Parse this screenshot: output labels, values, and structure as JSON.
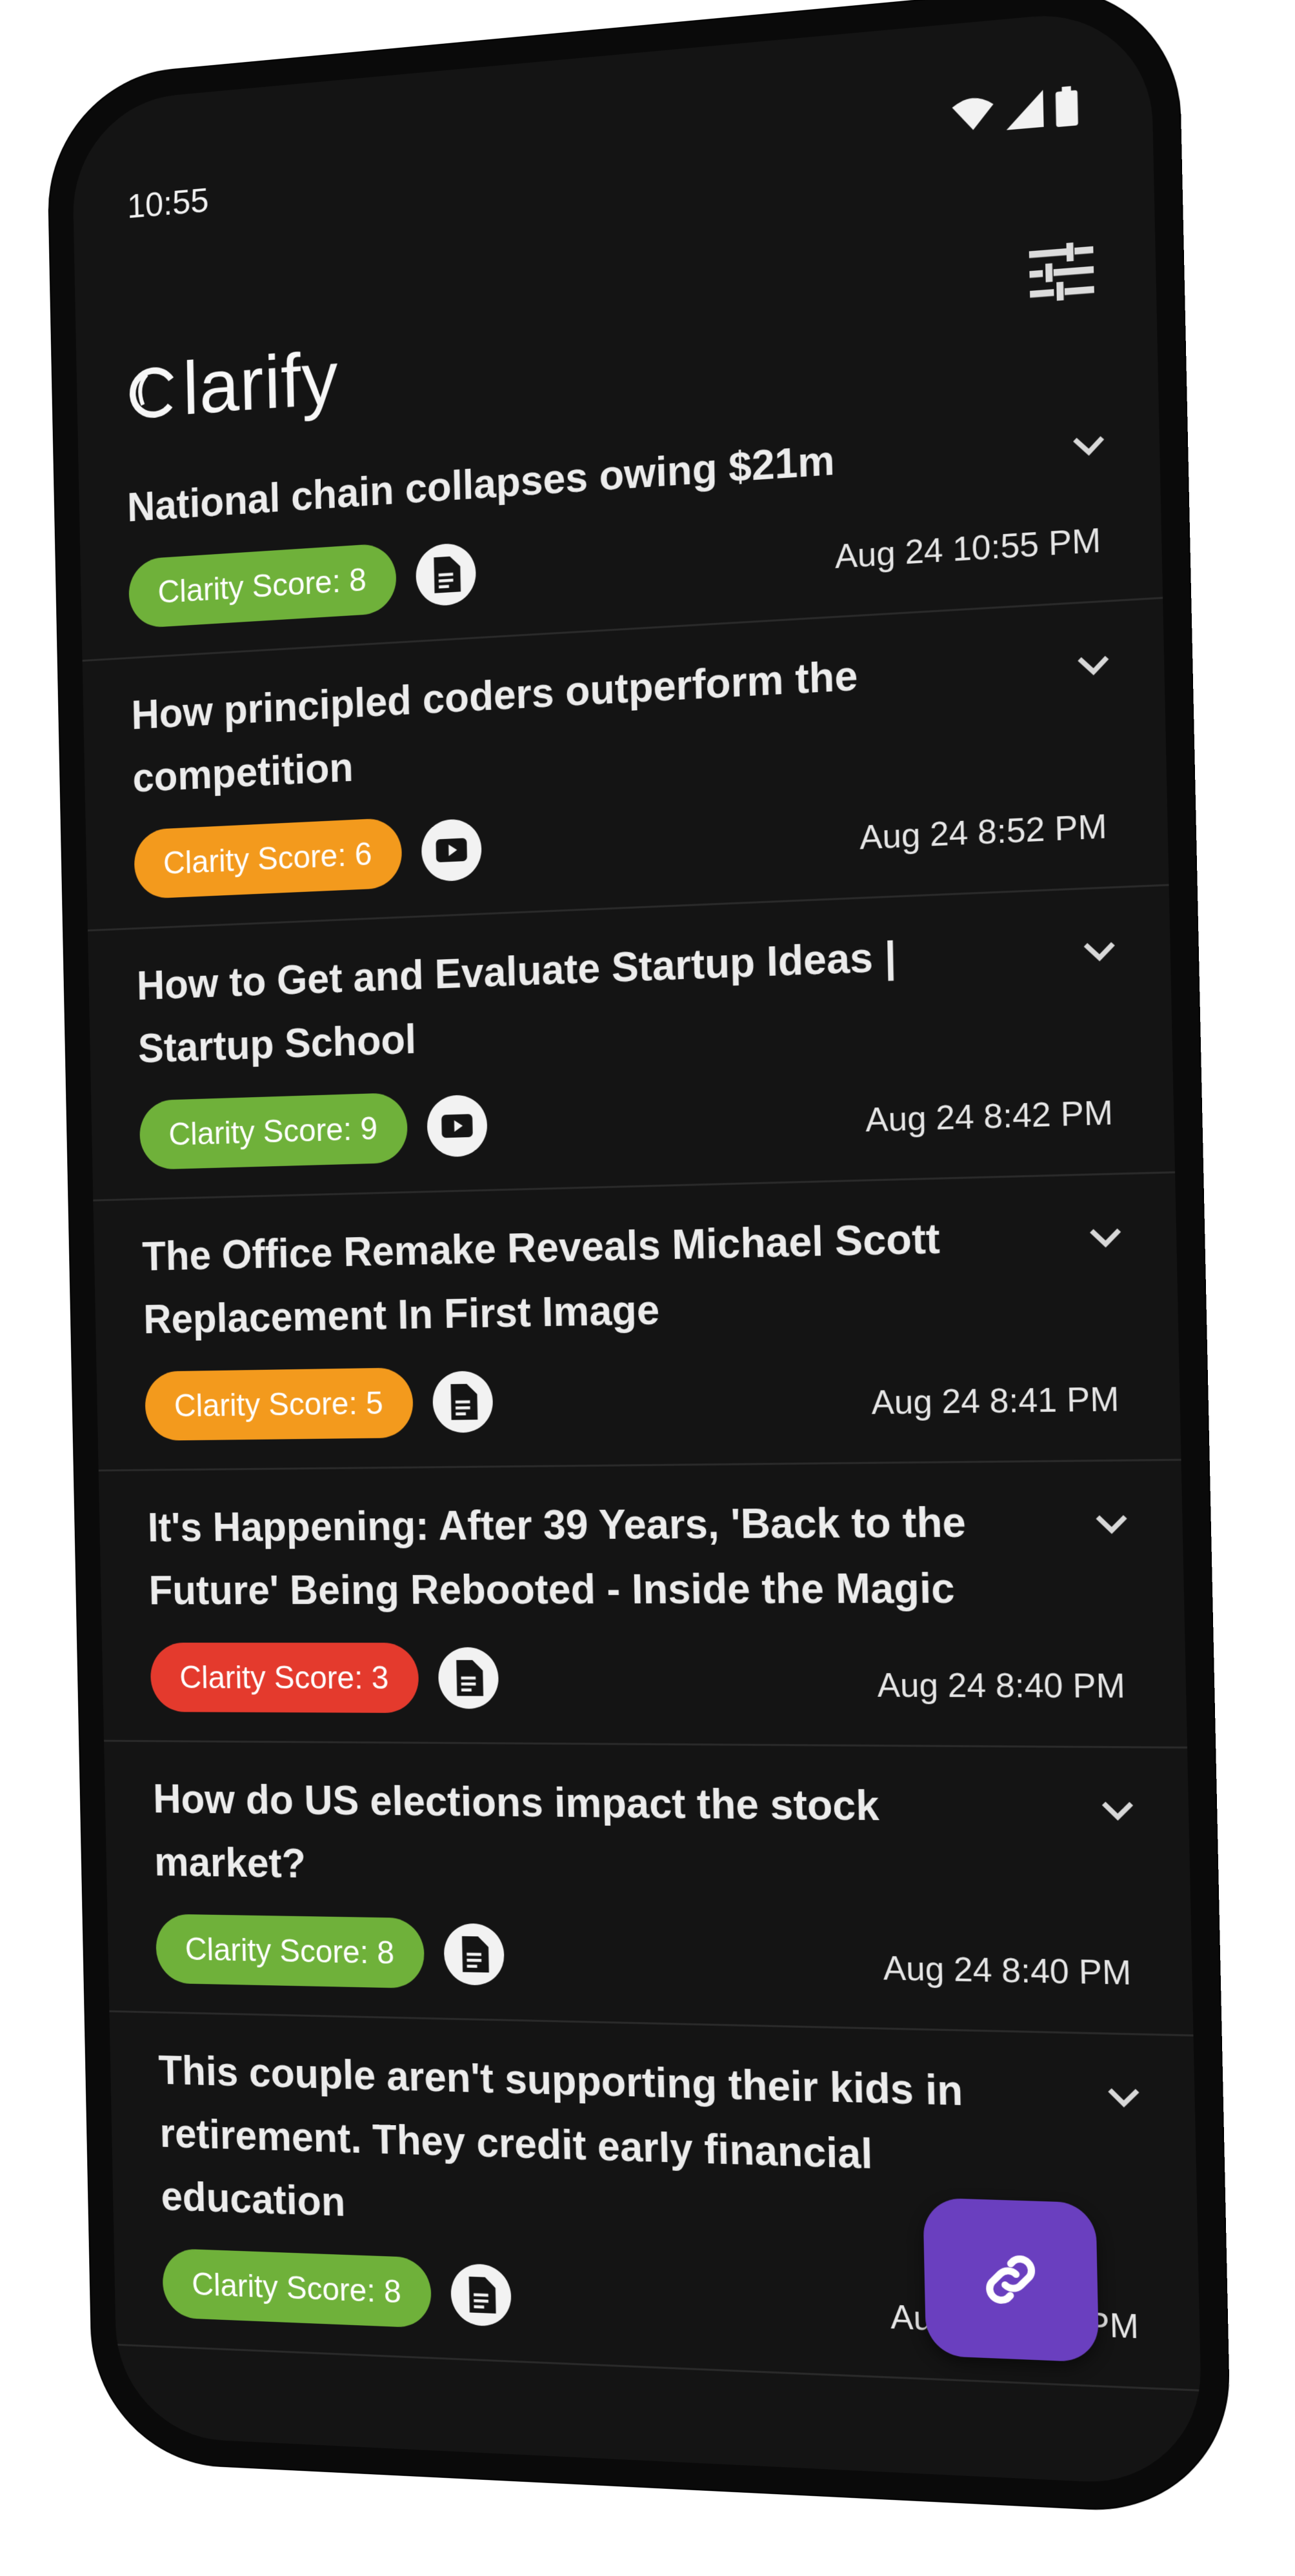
{
  "status_bar": {
    "time": "10:55"
  },
  "header": {
    "logo_text": "larify",
    "filter_icon": "tune-icon"
  },
  "colors": {
    "green": "#6fb13a",
    "orange": "#f39a1d",
    "red": "#e43a2d",
    "fab": "#6a3fbf"
  },
  "articles": [
    {
      "title": "National chain collapses owing $21m",
      "score_label": "Clarity Score: 8",
      "score_color": "green",
      "type": "document",
      "date": "Aug 24 10:55 PM"
    },
    {
      "title": "How principled coders outperform the competition",
      "score_label": "Clarity Score: 6",
      "score_color": "orange",
      "type": "video",
      "date": "Aug 24 8:52 PM"
    },
    {
      "title": "How to Get and Evaluate Startup Ideas | Startup School",
      "score_label": "Clarity Score: 9",
      "score_color": "green",
      "type": "video",
      "date": "Aug 24 8:42 PM"
    },
    {
      "title": "The Office Remake Reveals Michael Scott Replacement In First Image",
      "score_label": "Clarity Score: 5",
      "score_color": "orange",
      "type": "document",
      "date": "Aug 24 8:41 PM"
    },
    {
      "title": "It's Happening: After 39 Years, 'Back to the Future' Being Rebooted - Inside the Magic",
      "score_label": "Clarity Score: 3",
      "score_color": "red",
      "type": "document",
      "date": "Aug 24 8:40 PM"
    },
    {
      "title": "How do US elections impact the stock market?",
      "score_label": "Clarity Score: 8",
      "score_color": "green",
      "type": "document",
      "date": "Aug 24 8:40 PM"
    },
    {
      "title": "This couple aren't supporting their kids in retirement. They credit early financial education",
      "score_label": "Clarity Score: 8",
      "score_color": "green",
      "type": "document",
      "date": "Aug 24 8:37 PM"
    }
  ],
  "fab": {
    "icon": "link-icon"
  }
}
